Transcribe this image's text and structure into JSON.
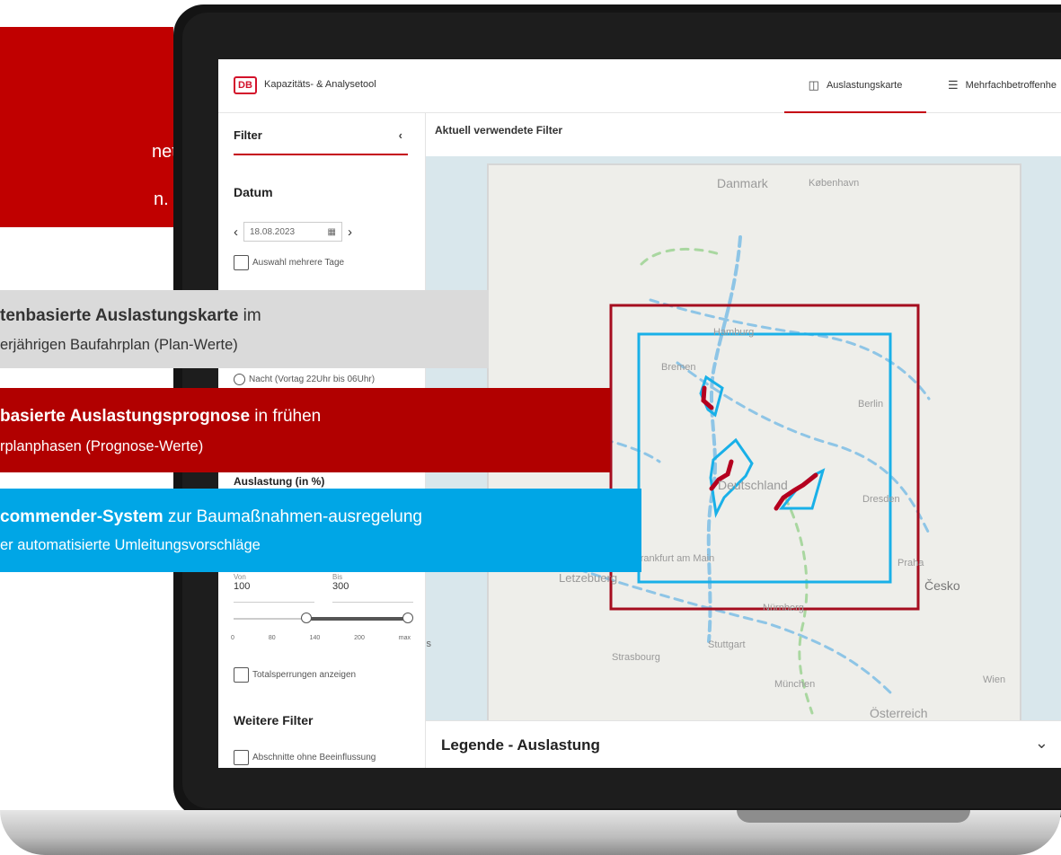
{
  "app": {
    "logo": "DB",
    "title": "Kapazitäts- & Analysetool",
    "tabs": [
      {
        "label": "Auslastungskarte",
        "icon": "map-icon",
        "active": true
      },
      {
        "label": "Mehrfachbetroffenhe",
        "icon": "list-icon",
        "active": false
      }
    ]
  },
  "sidebar": {
    "header": "Filter",
    "date_section": {
      "title": "Datum",
      "date_value": "18.08.2023",
      "multi_day_label": "Auswahl mehrere Tage"
    },
    "night_option": "Nacht (Vortag 22Uhr bis 06Uhr)",
    "load_section": {
      "title": "Auslastung (in %)",
      "from_label": "Von",
      "from_value": "100",
      "to_label": "Bis",
      "to_value": "300",
      "ticks": [
        "0",
        "80",
        "140",
        "200",
        "max"
      ]
    },
    "total_closures_label": "Totalsperrungen anzeigen",
    "more_filters_title": "Weitere Filter",
    "no_influence_label": "Abschnitte ohne Beeinflussung"
  },
  "main": {
    "title": "Aktuell verwendete Filter",
    "legend_title": "Legende - Auslastung",
    "map_labels": [
      "Danmark",
      "København",
      "Bremen",
      "Berlin",
      "Dresden",
      "Deutschland",
      "Frankfurt am Main",
      "Letzebuerg",
      "Praha",
      "Česko",
      "Nürnberg",
      "Stuttgart",
      "Strasbourg",
      "München",
      "Wien",
      "Österreich",
      "Hamburg",
      "is"
    ]
  },
  "overlay": {
    "red_block_lines": [
      "netz",
      "n."
    ],
    "gray_bar": {
      "bold": "tenbasierte Auslastungskarte",
      "rest1": " im",
      "line2": "erjährigen Baufahrplan (Plan-Werte)"
    },
    "red_bar": {
      "bold": "basierte Auslastungsprognose",
      "rest1": " in frühen",
      "line2": "rplanphasen (Prognose-Werte)"
    },
    "blue_bar": {
      "bold": "commender-System",
      "rest1": " zur Baumaßnahmen-ausregelung",
      "line2": "er automatisierte Umleitungsvorschläge"
    }
  },
  "colors": {
    "db_red": "#c50014",
    "overlay_red": "#b10000",
    "overlay_blue": "#00a6e6",
    "route_blue": "#8ec5e6",
    "highlight_blue": "#19b0e8",
    "frame_red": "#a50d1f"
  }
}
